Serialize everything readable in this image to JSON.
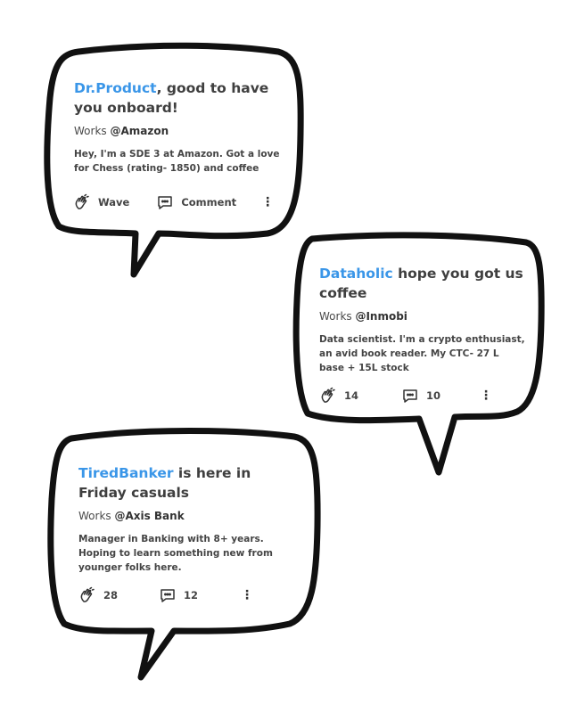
{
  "cards": [
    {
      "username": "Dr.Product",
      "title_rest": ", good to have you onboard!",
      "works_prefix": "Works ",
      "company": "@Amazon",
      "description": "Hey, I'm a SDE 3 at Amazon. Got a love for Chess (rating- 1850) and coffee",
      "wave": "Wave",
      "comment": "Comment"
    },
    {
      "username": "Dataholic",
      "title_rest": " hope you got us coffee",
      "works_prefix": "Works ",
      "company": "@Inmobi",
      "description": "Data scientist. I'm a crypto enthusiast, an avid book reader. My CTC- 27 L base + 15L stock",
      "wave": "14",
      "comment": "10"
    },
    {
      "username": "TiredBanker",
      "title_rest": " is here in Friday casuals",
      "works_prefix": "Works ",
      "company": "@Axis Bank",
      "description": "Manager in Banking with 8+ years. Hoping to learn something new from younger folks here.",
      "wave": "28",
      "comment": "12"
    }
  ],
  "icons": {
    "wave": "waving-hand-icon",
    "comment": "comment-icon",
    "more": "more-vertical-icon"
  },
  "colors": {
    "username": "#3a96e8",
    "outline": "#111111",
    "text": "#3f3f3f"
  }
}
